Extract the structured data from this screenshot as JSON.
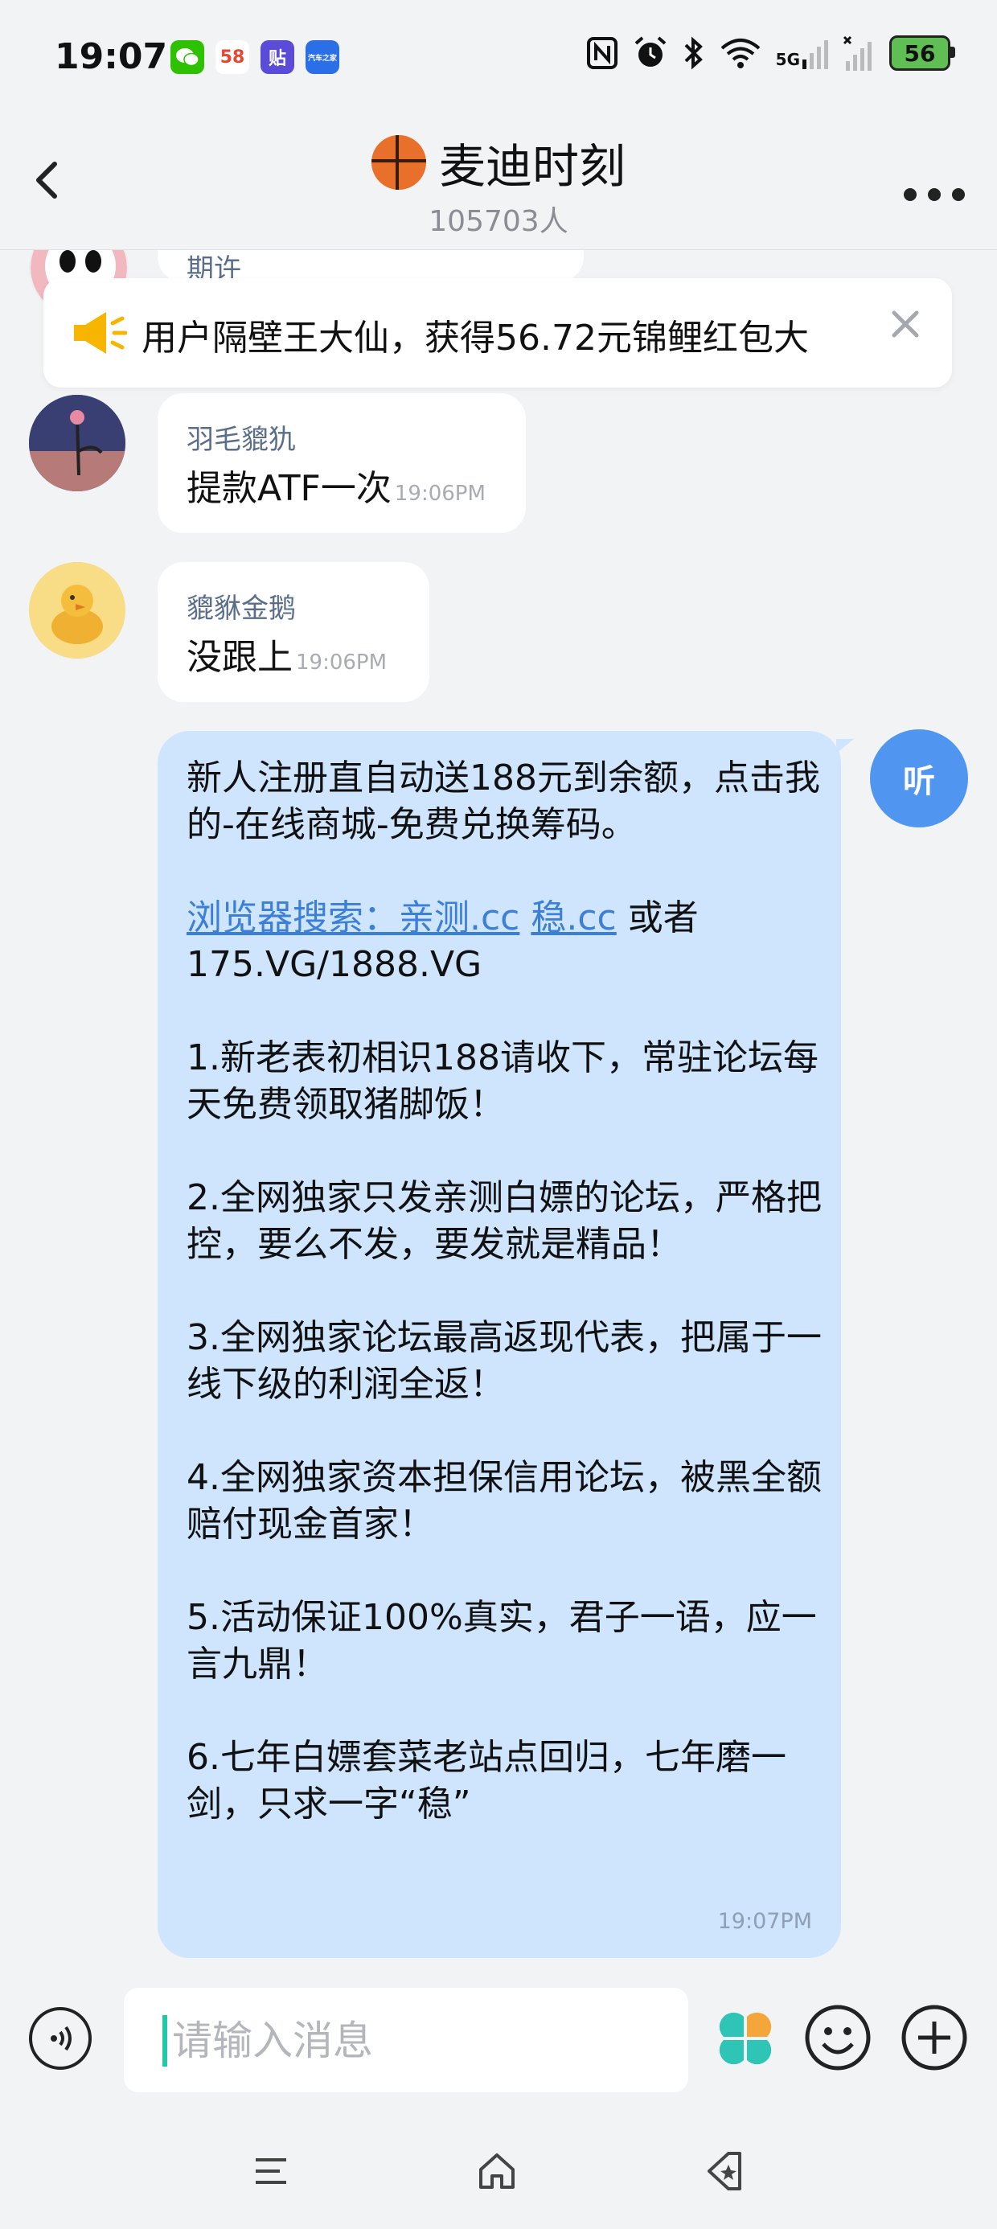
{
  "status_bar": {
    "time": "19:07",
    "apps": [
      {
        "icon": "wechat-icon",
        "label": "",
        "color": "#2dc100"
      },
      {
        "icon": "58-app-icon",
        "label": "58",
        "color": "#ff6a00"
      },
      {
        "icon": "tieba-app-icon",
        "label": "贴",
        "color": "#5b4cd8"
      },
      {
        "icon": "autohome-app-icon",
        "label": "汽车之家",
        "color": "#2b6fe8"
      }
    ],
    "signal_label": "5G",
    "battery": "56"
  },
  "header": {
    "title": "麦迪时刻",
    "members": "105703人",
    "icon": "basketball-icon"
  },
  "notice": {
    "text": "用户隔壁王大仙，获得56.72元锦鲤红包大",
    "icon": "megaphone-icon"
  },
  "messages": [
    {
      "sender": "期许",
      "text": "",
      "time": ""
    },
    {
      "sender": "羽毛貔犰",
      "text": "提款ATF一次",
      "time": "19:06PM"
    },
    {
      "sender": "貔貅金鹅",
      "text": "没跟上",
      "time": "19:06PM"
    }
  ],
  "own_message": {
    "line1": "新人注册直自动送188元到余额，点击我的-在线商城-免费兑换筹码。",
    "link1": "浏览器搜索：亲测.cc",
    "link2": "稳.cc",
    "after_links": " 或者 175.VG/1888.VG",
    "p1": "1.新老表初相识188请收下，常驻论坛每天免费领取猪脚饭！",
    "p2": "2.全网独家只发亲测白嫖的论坛，严格把控，要么不发，要发就是精品！",
    "p3": "3.全网独家论坛最高返现代表，把属于一线下级的利润全返！",
    "p4": "4.全网独家资本担保信用论坛，被黑全额赔付现金首家！",
    "p5": "5.活动保证100%真实，君子一语，应一言九鼎！",
    "p6": "6.七年白嫖套菜老站点回归，七年磨一剑，只求一字“稳”",
    "time": "19:07PM",
    "listen_label": "听"
  },
  "input": {
    "placeholder": "请输入消息",
    "value": ""
  },
  "colors": {
    "accent": "#5096f0",
    "own_bubble": "#cfe4fd",
    "caret": "#21c7a8"
  }
}
